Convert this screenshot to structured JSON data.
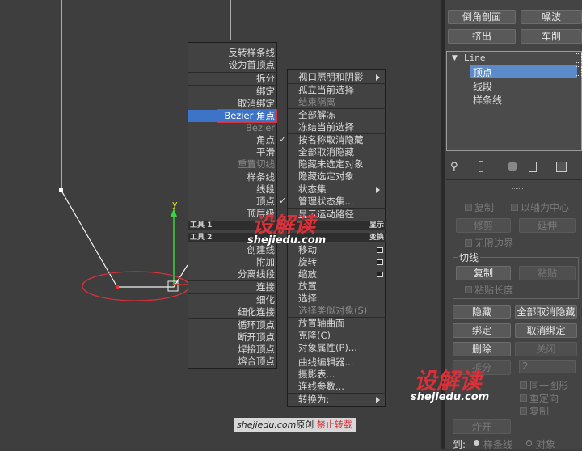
{
  "panel_top": {
    "chamfer_cross": "倒角剖面",
    "noise": "噪波",
    "extrude": "挤出",
    "lathe": "车削"
  },
  "tree": {
    "root": "Line",
    "items": [
      "顶点",
      "线段",
      "样条线"
    ]
  },
  "panel_sections": {
    "copy": "复制",
    "axis_center": "以轴为中心",
    "trim": "修剪",
    "extend": "延伸",
    "infinite_bounds": "无限边界",
    "tangent": "切线",
    "tan_copy": "复制",
    "tan_paste": "粘贴",
    "paste_length": "粘贴长度",
    "hide": "隐藏",
    "unhide_all": "全部取消隐藏",
    "bind": "绑定",
    "unbind": "取消绑定",
    "delete": "删除",
    "close": "关闭",
    "divide": "拆分",
    "divide_value": "2",
    "same_shape": "同一图形",
    "reorient": "重定向",
    "copy2": "复制",
    "explode": "炸开",
    "to": "到:",
    "to_spline": "样条线",
    "to_object": "对象"
  },
  "menu_left": {
    "items": [
      "反转样条线",
      "设为首顶点",
      "拆分",
      "绑定",
      "取消绑定",
      "Bezier 角点",
      "Bezier",
      "角点",
      "平滑",
      "重置切线",
      "样条线",
      "线段",
      "顶点",
      "顶层级"
    ],
    "tools1": "工具 1",
    "tools2": "工具 2",
    "lower": [
      "创建线",
      "附加",
      "分离线段",
      "连接",
      "细化",
      "细化连接",
      "循环顶点",
      "断开顶点",
      "焊接顶点",
      "熔合顶点"
    ]
  },
  "menu_right": {
    "items": [
      "视口照明和阴影",
      "孤立当前选择",
      "结束隔离",
      "全部解冻",
      "冻结当前选择",
      "按名称取消隐藏",
      "全部取消隐藏",
      "隐藏未选定对象",
      "隐藏选定对象",
      "状态集",
      "管理状态集...",
      "显示运动路径"
    ],
    "display": "显示",
    "transform": "变换",
    "lower": [
      "移动",
      "旋转",
      "缩放",
      "放置",
      "选择",
      "选择类似对象(S)",
      "放置轴曲面",
      "克隆(C)",
      "对象属性(P)...",
      "曲线编辑器...",
      "摄影表...",
      "连线参数...",
      "转换为:"
    ]
  },
  "watermark": {
    "brand": "设解读",
    "url": "shejiedu.com",
    "caption_a": "shejiedu.com",
    "caption_b": "原创",
    "caption_c": "禁止转载"
  },
  "colors": {
    "highlight": "#3e74c8",
    "watermark_red": "#d9303a",
    "gizmo_green": "#3cd23c"
  }
}
